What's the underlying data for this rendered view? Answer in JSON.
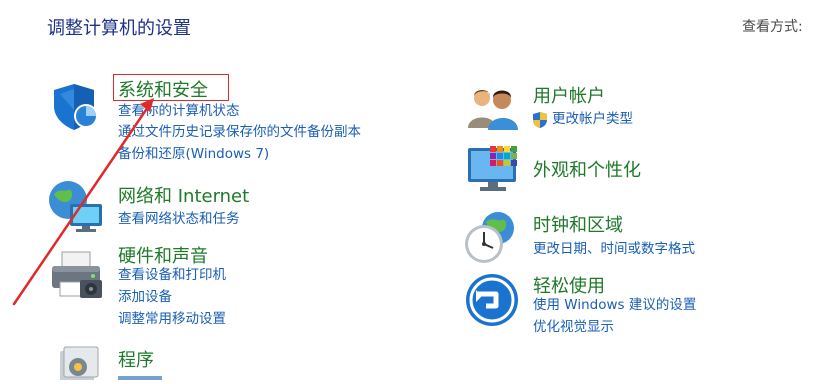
{
  "header": {
    "title": "调整计算机的设置",
    "view_by_label": "查看方式:"
  },
  "left": {
    "system": {
      "title": "系统和安全",
      "links": [
        "查看你的计算机状态",
        "通过文件历史记录保存你的文件备份副本",
        "备份和还原(Windows 7)"
      ]
    },
    "network": {
      "title": "网络和 Internet",
      "links": [
        "查看网络状态和任务"
      ]
    },
    "hardware": {
      "title": "硬件和声音",
      "links": [
        "查看设备和打印机",
        "添加设备",
        "调整常用移动设置"
      ]
    },
    "programs": {
      "title": "程序"
    }
  },
  "right": {
    "accounts": {
      "title": "用户帐户",
      "links": [
        "更改帐户类型"
      ]
    },
    "appearance": {
      "title": "外观和个性化"
    },
    "clock": {
      "title": "时钟和区域",
      "links": [
        "更改日期、时间或数字格式"
      ]
    },
    "ease": {
      "title": "轻松使用",
      "links": [
        "使用 Windows 建议的设置",
        "优化视觉显示"
      ]
    }
  },
  "annotation": {
    "box_color": "#e02a2a",
    "arrow_color": "#e02a2a"
  }
}
